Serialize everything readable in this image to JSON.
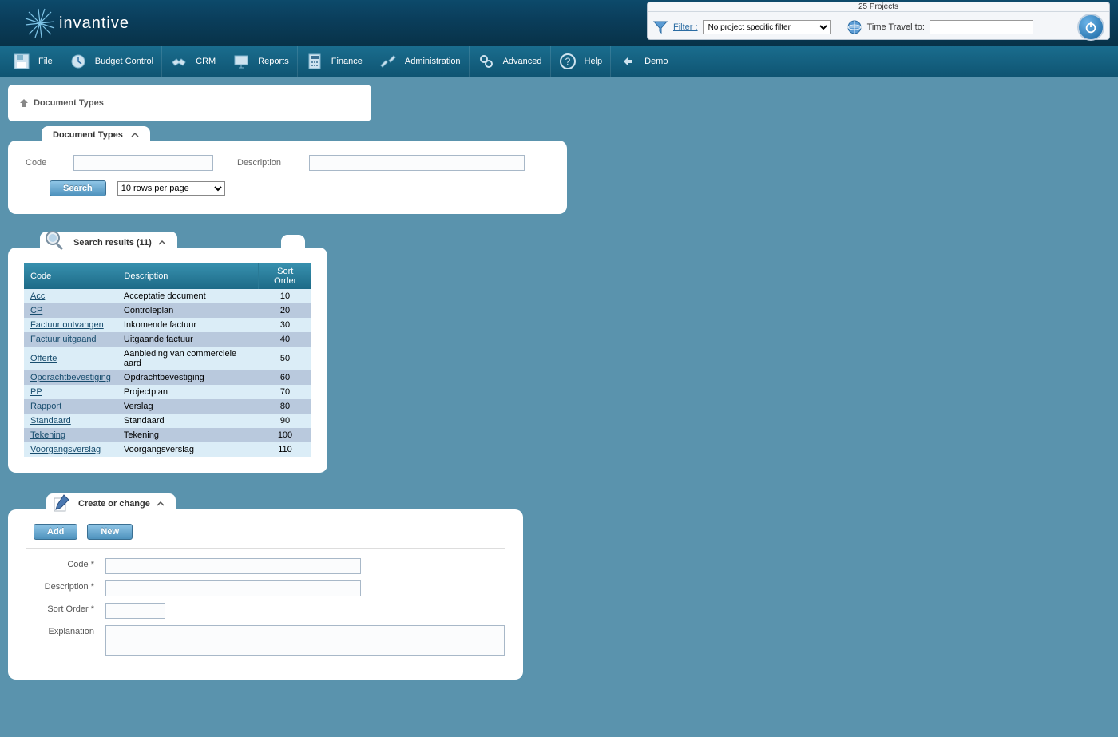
{
  "logo": "invantive",
  "top_bar": {
    "projects_count": "25 Projects",
    "filter_label": "Filter :",
    "filter_value": "No project specific filter",
    "time_travel_label": "Time Travel to:",
    "time_travel_value": ""
  },
  "menu": {
    "file": "File",
    "budget": "Budget Control",
    "crm": "CRM",
    "reports": "Reports",
    "finance": "Finance",
    "admin": "Administration",
    "advanced": "Advanced",
    "help": "Help",
    "demo": "Demo"
  },
  "breadcrumb": "Document Types",
  "search_panel": {
    "tab_title": "Document Types",
    "code_label": "Code",
    "desc_label": "Description",
    "search_btn": "Search",
    "rows_label": "10 rows per page"
  },
  "results": {
    "tab_title": "Search results (11)",
    "columns": {
      "code": "Code",
      "description": "Description",
      "sort": "Sort Order"
    },
    "rows": [
      {
        "code": "Acc",
        "desc": "Acceptatie document",
        "sort": "10"
      },
      {
        "code": "CP",
        "desc": "Controleplan",
        "sort": "20"
      },
      {
        "code": "Factuur ontvangen",
        "desc": "Inkomende factuur",
        "sort": "30"
      },
      {
        "code": "Factuur uitgaand",
        "desc": "Uitgaande factuur",
        "sort": "40"
      },
      {
        "code": "Offerte",
        "desc": "Aanbieding van commerciele aard",
        "sort": "50"
      },
      {
        "code": "Opdrachtbevestiging",
        "desc": "Opdrachtbevestiging",
        "sort": "60"
      },
      {
        "code": "PP",
        "desc": "Projectplan",
        "sort": "70"
      },
      {
        "code": "Rapport",
        "desc": "Verslag",
        "sort": "80"
      },
      {
        "code": "Standaard",
        "desc": "Standaard",
        "sort": "90"
      },
      {
        "code": "Tekening",
        "desc": "Tekening",
        "sort": "100"
      },
      {
        "code": "Voorgangsverslag",
        "desc": "Voorgangsverslag",
        "sort": "110"
      }
    ]
  },
  "create": {
    "tab_title": "Create or change",
    "add_btn": "Add",
    "new_btn": "New",
    "code_label": "Code *",
    "desc_label": "Description *",
    "sort_label": "Sort Order *",
    "expl_label": "Explanation"
  }
}
